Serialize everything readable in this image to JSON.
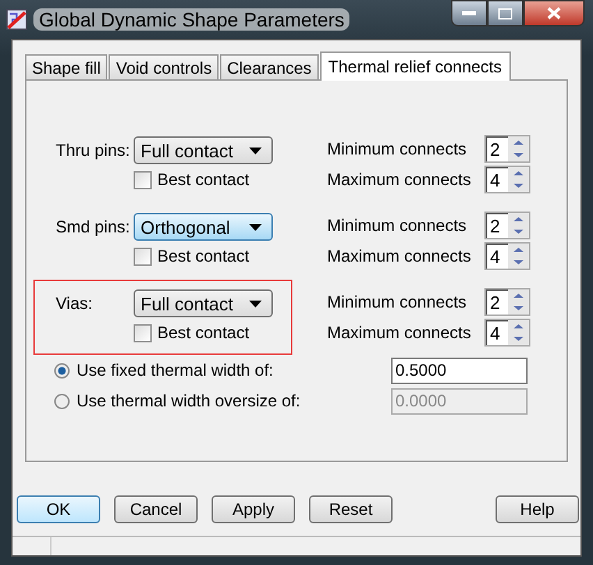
{
  "window": {
    "title": "Global Dynamic Shape Parameters"
  },
  "tabs": [
    {
      "label": "Shape fill",
      "selected": false
    },
    {
      "label": "Void controls",
      "selected": false
    },
    {
      "label": "Clearances",
      "selected": false
    },
    {
      "label": "Thermal relief connects",
      "selected": true
    }
  ],
  "pin_rows": [
    {
      "label": "Thru pins:",
      "mode": "Full contact",
      "focused": false,
      "highlighted": false,
      "best_contact": {
        "label": "Best contact",
        "checked": false
      },
      "spins": [
        {
          "label": "Minimum connects",
          "value": "2"
        },
        {
          "label": "Maximum connects",
          "value": "4"
        }
      ]
    },
    {
      "label": "Smd pins:",
      "mode": "Orthogonal",
      "focused": true,
      "highlighted": false,
      "best_contact": {
        "label": "Best contact",
        "checked": false
      },
      "spins": [
        {
          "label": "Minimum connects",
          "value": "2"
        },
        {
          "label": "Maximum connects",
          "value": "4"
        }
      ]
    },
    {
      "label": "Vias:",
      "mode": "Full contact",
      "focused": false,
      "highlighted": true,
      "best_contact": {
        "label": "Best contact",
        "checked": false
      },
      "spins": [
        {
          "label": "Minimum connects",
          "value": "2"
        },
        {
          "label": "Maximum connects",
          "value": "4"
        }
      ]
    }
  ],
  "thermal_width": [
    {
      "label": "Use fixed thermal width of:",
      "selected": true,
      "value": "0.5000",
      "disabled": false
    },
    {
      "label": "Use thermal width oversize of:",
      "selected": false,
      "value": "0.0000",
      "disabled": true
    }
  ],
  "buttons": [
    {
      "label": "OK",
      "default": true
    },
    {
      "label": "Cancel",
      "default": false
    },
    {
      "label": "Apply",
      "default": false
    },
    {
      "label": "Reset",
      "default": false
    }
  ],
  "help_button": {
    "label": "Help"
  }
}
